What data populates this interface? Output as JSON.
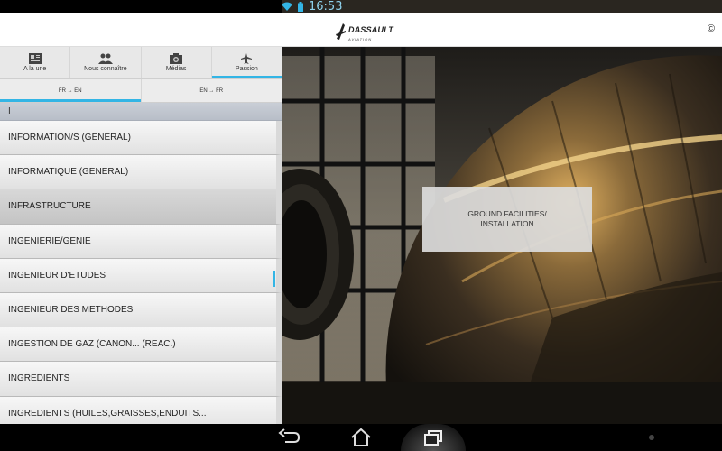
{
  "status_bar": {
    "time": "16:53"
  },
  "header": {
    "copyright": "©",
    "logo": {
      "word": "DASSAULT",
      "sub": "AVIATION"
    }
  },
  "tabs": [
    {
      "label": "A la une",
      "icon": "newspaper-icon"
    },
    {
      "label": "Nous connaître",
      "icon": "people-icon"
    },
    {
      "label": "Médias",
      "icon": "camera-icon"
    },
    {
      "label": "Passion",
      "icon": "airplane-icon",
      "active": true
    }
  ],
  "subtabs": [
    {
      "label": "FR → EN",
      "active": true
    },
    {
      "label": "EN → FR"
    }
  ],
  "letter_header": "I",
  "list_items": [
    "INFORMATION/S (GENERAL)",
    "INFORMATIQUE (GENERAL)",
    "INFRASTRUCTURE",
    "INGENIERIE/GENIE",
    "INGENIEUR D'ETUDES",
    "INGENIEUR DES METHODES",
    "INGESTION DE GAZ (CANON... (REAC.)",
    "INGREDIENTS",
    "INGREDIENTS (HUILES,GRAISSES,ENDUITS..."
  ],
  "overlay_card": {
    "text": "GROUND FACILITIES/ INSTALLATION"
  },
  "colors": {
    "accent": "#33b5e5"
  }
}
